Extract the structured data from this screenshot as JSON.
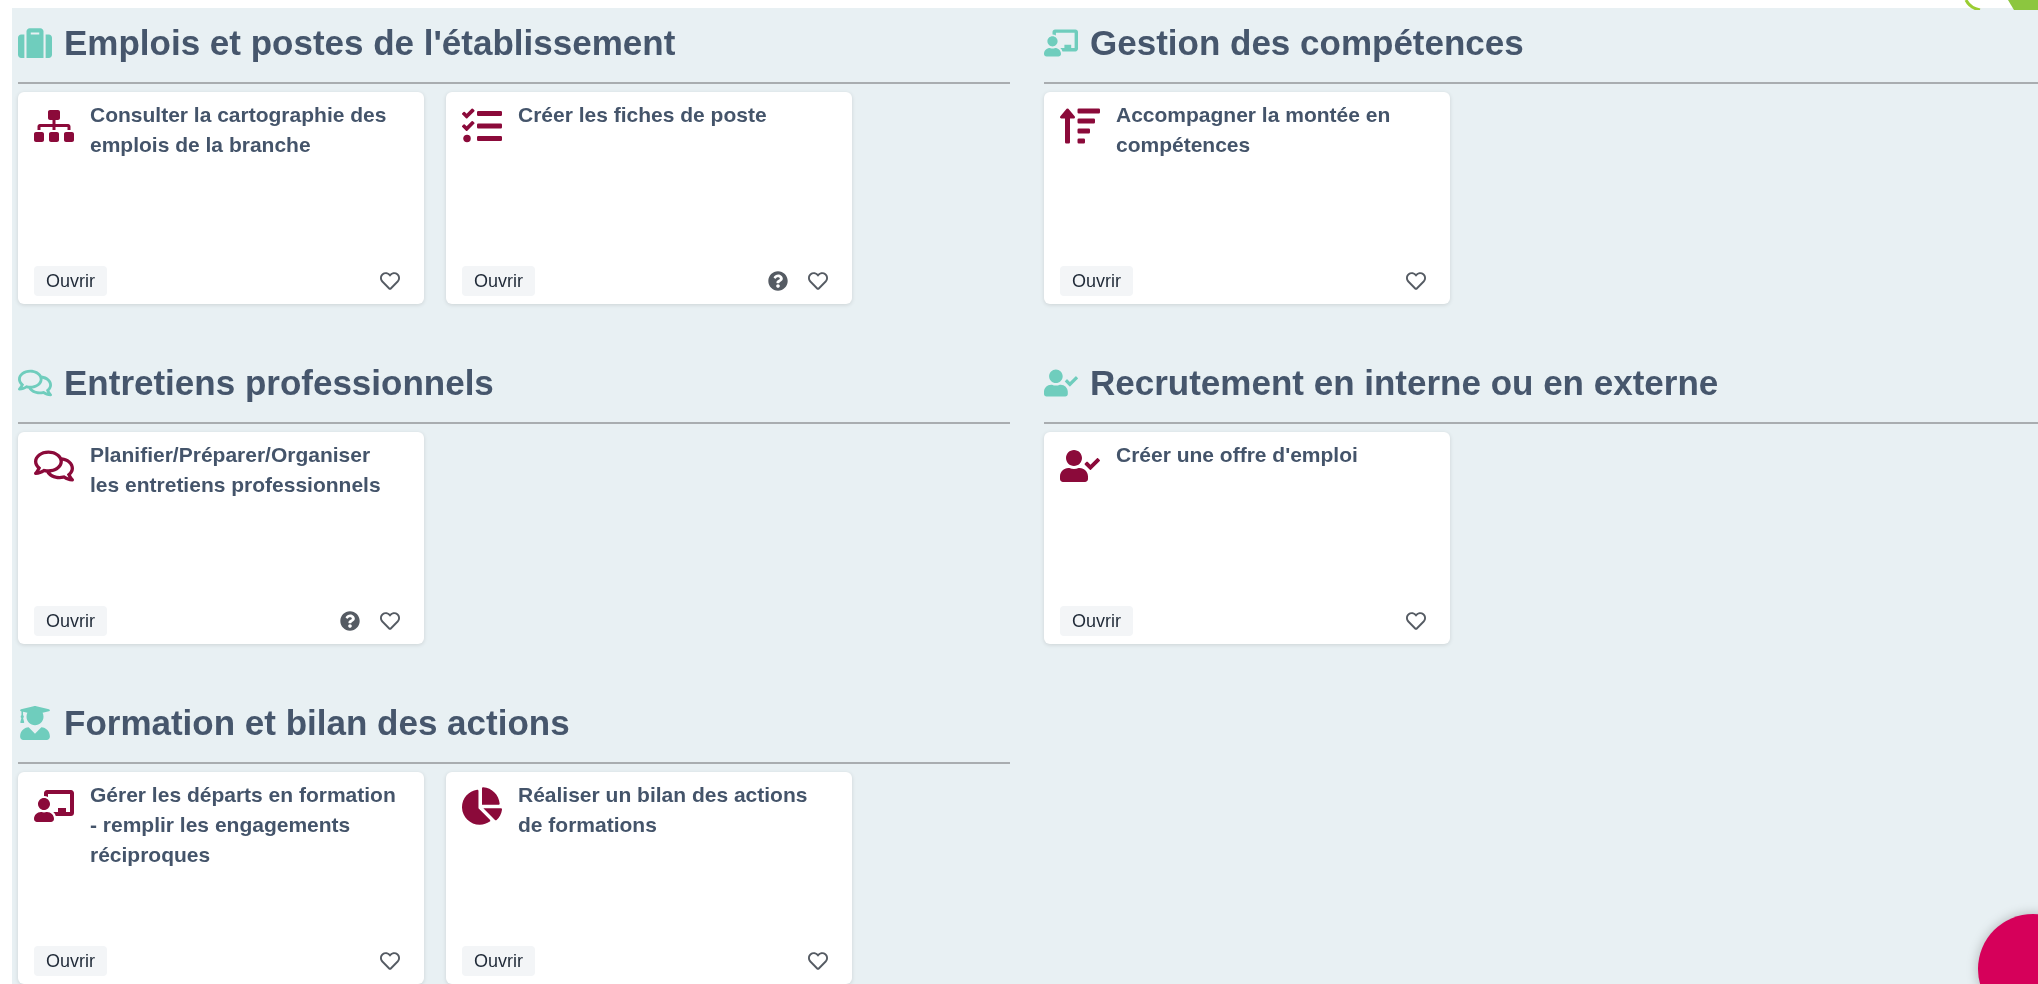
{
  "sections": [
    {
      "title": "Emplois et postes de l'établissement",
      "cards": [
        {
          "title": "Consulter la cartographie des emplois de la branche",
          "button": "Ouvrir",
          "help": false,
          "favorite": false
        },
        {
          "title": "Créer les fiches de poste",
          "button": "Ouvrir",
          "help": true,
          "favorite": false
        }
      ]
    },
    {
      "title": "Gestion des compétences",
      "cards": [
        {
          "title": "Accompagner la montée en compétences",
          "button": "Ouvrir",
          "help": false,
          "favorite": false
        }
      ]
    },
    {
      "title": "Entretiens professionnels",
      "cards": [
        {
          "title": "Planifier/Préparer/Organiser les entretiens professionnels",
          "button": "Ouvrir",
          "help": true,
          "favorite": false
        }
      ]
    },
    {
      "title": "Recrutement en interne ou en externe",
      "cards": [
        {
          "title": "Créer une offre d'emploi",
          "button": "Ouvrir",
          "help": false,
          "favorite": false
        }
      ]
    },
    {
      "title": "Formation et bilan des actions",
      "cards": [
        {
          "title": "Gérer les départs en formation - remplir les engagements réciproques",
          "button": "Ouvrir",
          "help": false,
          "favorite": false
        },
        {
          "title": "Réaliser un bilan des actions de formations",
          "button": "Ouvrir",
          "help": false,
          "favorite": false
        }
      ]
    }
  ]
}
